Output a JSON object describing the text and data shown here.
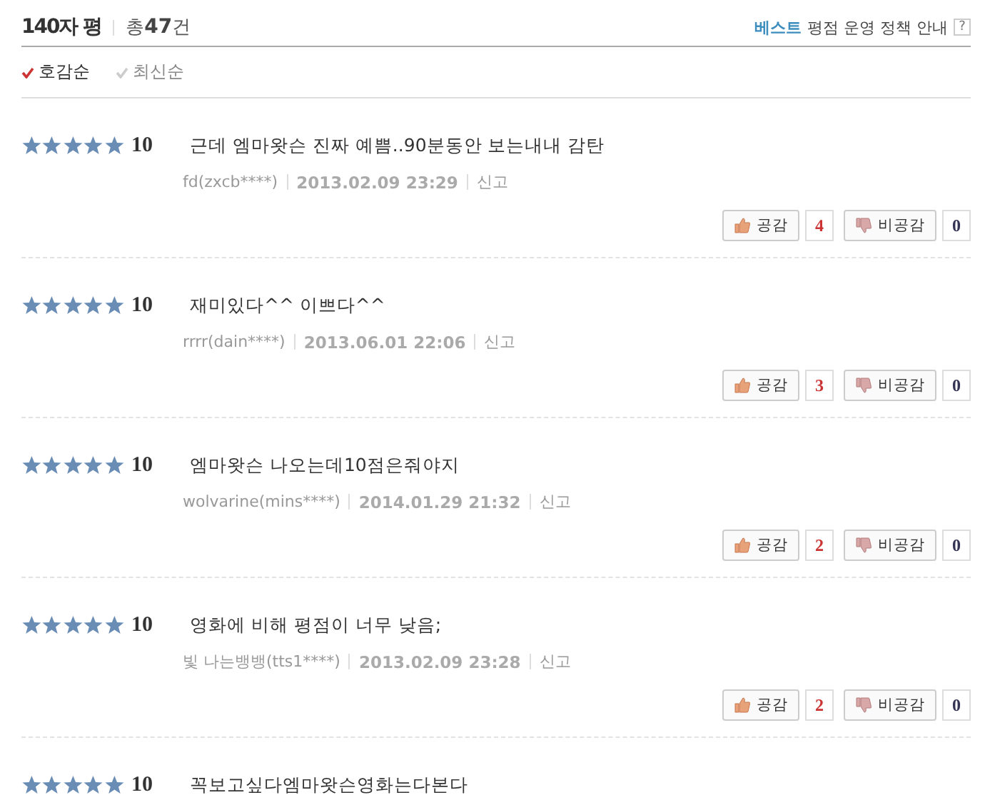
{
  "header": {
    "title": "140자 평",
    "total_prefix": "총",
    "total_count": "47",
    "total_suffix": "건",
    "policy_highlight": "베스트",
    "policy_text": "평점 운영 정책 안내",
    "help": "?"
  },
  "sort_options": [
    {
      "label": "호감순",
      "selected": true
    },
    {
      "label": "최신순",
      "selected": false
    }
  ],
  "reviews": [
    {
      "stars": 5,
      "score": "10",
      "text": "근데 엠마왓슨 진짜 예쁨..90분동안 보는내내 감탄",
      "author": "fd(zxcb****)",
      "date": "2013.02.09 23:29",
      "report": "신고",
      "like_label": "공감",
      "likes": "4",
      "dislike_label": "비공감",
      "dislikes": "0"
    },
    {
      "stars": 5,
      "score": "10",
      "text": "재미있다^^ 이쁘다^^",
      "author": "rrrr(dain****)",
      "date": "2013.06.01 22:06",
      "report": "신고",
      "like_label": "공감",
      "likes": "3",
      "dislike_label": "비공감",
      "dislikes": "0"
    },
    {
      "stars": 5,
      "score": "10",
      "text": "엠마왓슨 나오는데10점은줘야지",
      "author": "wolvarine(mins****)",
      "date": "2014.01.29 21:32",
      "report": "신고",
      "like_label": "공감",
      "likes": "2",
      "dislike_label": "비공감",
      "dislikes": "0"
    },
    {
      "stars": 5,
      "score": "10",
      "text": "영화에 비해 평점이 너무 낮음;",
      "author": "빛 나는뱅뱅(tts1****)",
      "date": "2013.02.09 23:28",
      "report": "신고",
      "like_label": "공감",
      "likes": "2",
      "dislike_label": "비공감",
      "dislikes": "0"
    },
    {
      "stars": 5,
      "score": "10",
      "text": "꼭보고싶다엠마왓슨영화는다본다"
    }
  ]
}
